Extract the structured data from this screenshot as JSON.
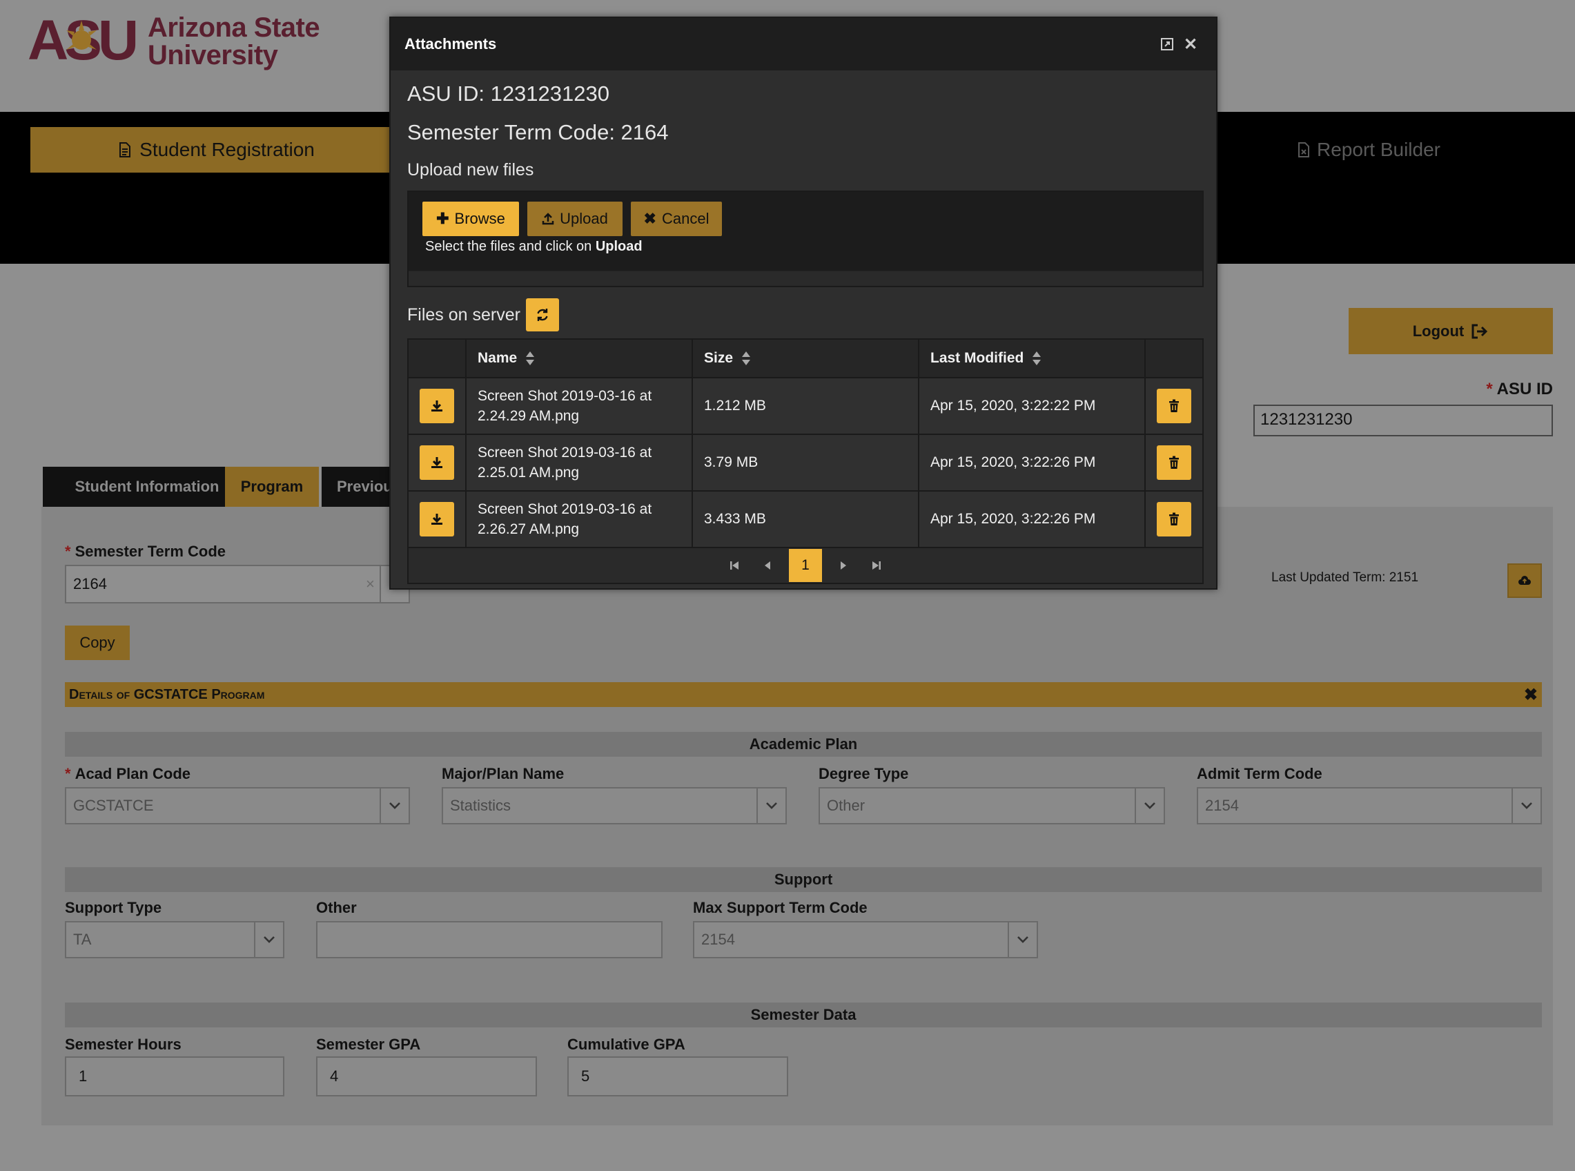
{
  "header": {
    "university_name_line1": "Arizona State",
    "university_name_line2": "University"
  },
  "nav": {
    "active_label": "Student Registration",
    "right_label": "Report Builder"
  },
  "account": {
    "logout_label": "Logout",
    "asu_id_label": "ASU ID",
    "asu_id_value": "1231231230"
  },
  "tabs": [
    {
      "label": "Student Information"
    },
    {
      "label": "Program"
    },
    {
      "label": "Previou"
    }
  ],
  "program_form": {
    "semester_term_code_label": "Semester Term Code",
    "semester_term_code_value": "2164",
    "last_updated_text": "Last Updated Term: 2151",
    "copy_label": "Copy",
    "details_title": "Details of GCSTATCE Program",
    "sections": {
      "academic_plan": "Academic Plan",
      "support": "Support",
      "semester_data": "Semester Data"
    },
    "academic_plan": {
      "acad_plan_code_label": "Acad Plan Code",
      "acad_plan_code_value": "GCSTATCE",
      "major_label": "Major/Plan Name",
      "major_value": "Statistics",
      "degree_type_label": "Degree Type",
      "degree_type_value": "Other",
      "admit_term_label": "Admit Term Code",
      "admit_term_value": "2154"
    },
    "support": {
      "support_type_label": "Support Type",
      "support_type_value": "TA",
      "other_label": "Other",
      "other_value": "",
      "max_term_label": "Max Support Term Code",
      "max_term_value": "2154"
    },
    "semester_data": {
      "hours_label": "Semester Hours",
      "hours_value": "1",
      "gpa_label": "Semester GPA",
      "gpa_value": "4",
      "cum_gpa_label": "Cumulative GPA",
      "cum_gpa_value": "5"
    }
  },
  "modal": {
    "title": "Attachments",
    "asu_id_line": "ASU ID: 1231231230",
    "term_line": "Semester Term Code: 2164",
    "upload_heading": "Upload new files",
    "browse_label": "Browse",
    "upload_label": "Upload",
    "cancel_label": "Cancel",
    "hint_prefix": "Select the files and click on",
    "hint_bold": "Upload",
    "files_heading": "Files on server",
    "columns": {
      "name": "Name",
      "size": "Size",
      "modified": "Last Modified"
    },
    "files": [
      {
        "name_line1": "Screen Shot 2019-03-16 at",
        "name_line2": "2.24.29 AM.png",
        "size": "1.212 MB",
        "modified": "Apr 15, 2020, 3:22:22 PM"
      },
      {
        "name_line1": "Screen Shot 2019-03-16 at",
        "name_line2": "2.25.01 AM.png",
        "size": "3.79 MB",
        "modified": "Apr 15, 2020, 3:22:26 PM"
      },
      {
        "name_line1": "Screen Shot 2019-03-16 at",
        "name_line2": "2.26.27 AM.png",
        "size": "3.433 MB",
        "modified": "Apr 15, 2020, 3:22:26 PM"
      }
    ],
    "pager": {
      "current_page": "1"
    }
  },
  "colors": {
    "asu_maroon": "#5a1f2f",
    "asu_gold": "#f0b53a",
    "dim_gold": "#8c6a24"
  }
}
